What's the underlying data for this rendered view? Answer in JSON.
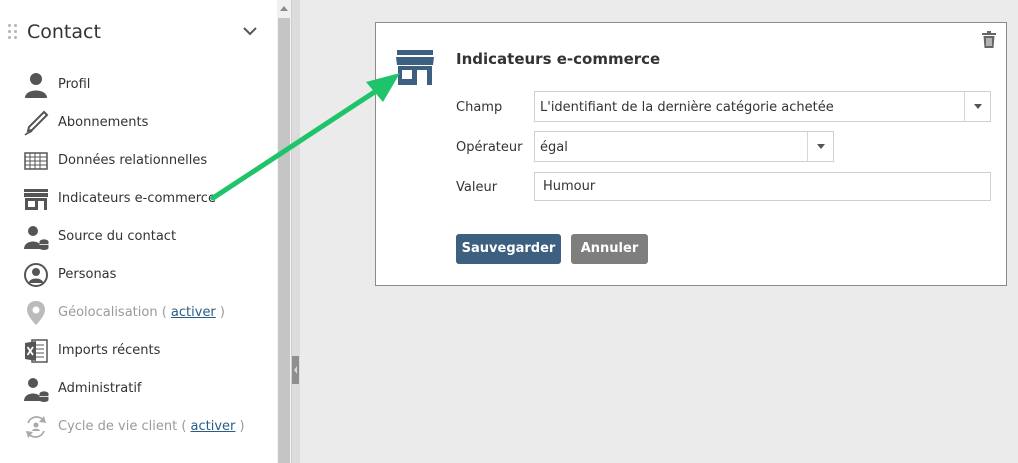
{
  "sidebar": {
    "title": "Contact",
    "items": [
      {
        "label": "Profil",
        "icon": "user-icon"
      },
      {
        "label": "Abonnements",
        "icon": "pen-icon"
      },
      {
        "label": "Données relationnelles",
        "icon": "table-icon"
      },
      {
        "label": "Indicateurs e-commerce",
        "icon": "shop-icon"
      },
      {
        "label": "Source du contact",
        "icon": "user-database-icon"
      },
      {
        "label": "Personas",
        "icon": "persona-icon"
      },
      {
        "label": "Géolocalisation (",
        "link": "activer",
        "suffix": ")",
        "icon": "map-pin-icon",
        "disabled": true
      },
      {
        "label": "Imports récents",
        "icon": "excel-icon"
      },
      {
        "label": "Administratif",
        "icon": "user-database-icon"
      },
      {
        "label": "Cycle de vie client (",
        "link": "activer",
        "suffix": ")",
        "icon": "lifecycle-icon",
        "disabled": true
      }
    ]
  },
  "panel": {
    "title": "Indicateurs e-commerce",
    "fields": {
      "champ": {
        "label": "Champ",
        "value": "L'identifiant de la dernière catégorie achetée"
      },
      "operateur": {
        "label": "Opérateur",
        "value": "égal"
      },
      "valeur": {
        "label": "Valeur",
        "value": "Humour"
      }
    },
    "save_label": "Sauvegarder",
    "cancel_label": "Annuler"
  },
  "colors": {
    "primary": "#3d5f80",
    "secondary": "#7e7e7e",
    "link": "#2a5d86",
    "annotation_arrow": "#1fc46a"
  }
}
